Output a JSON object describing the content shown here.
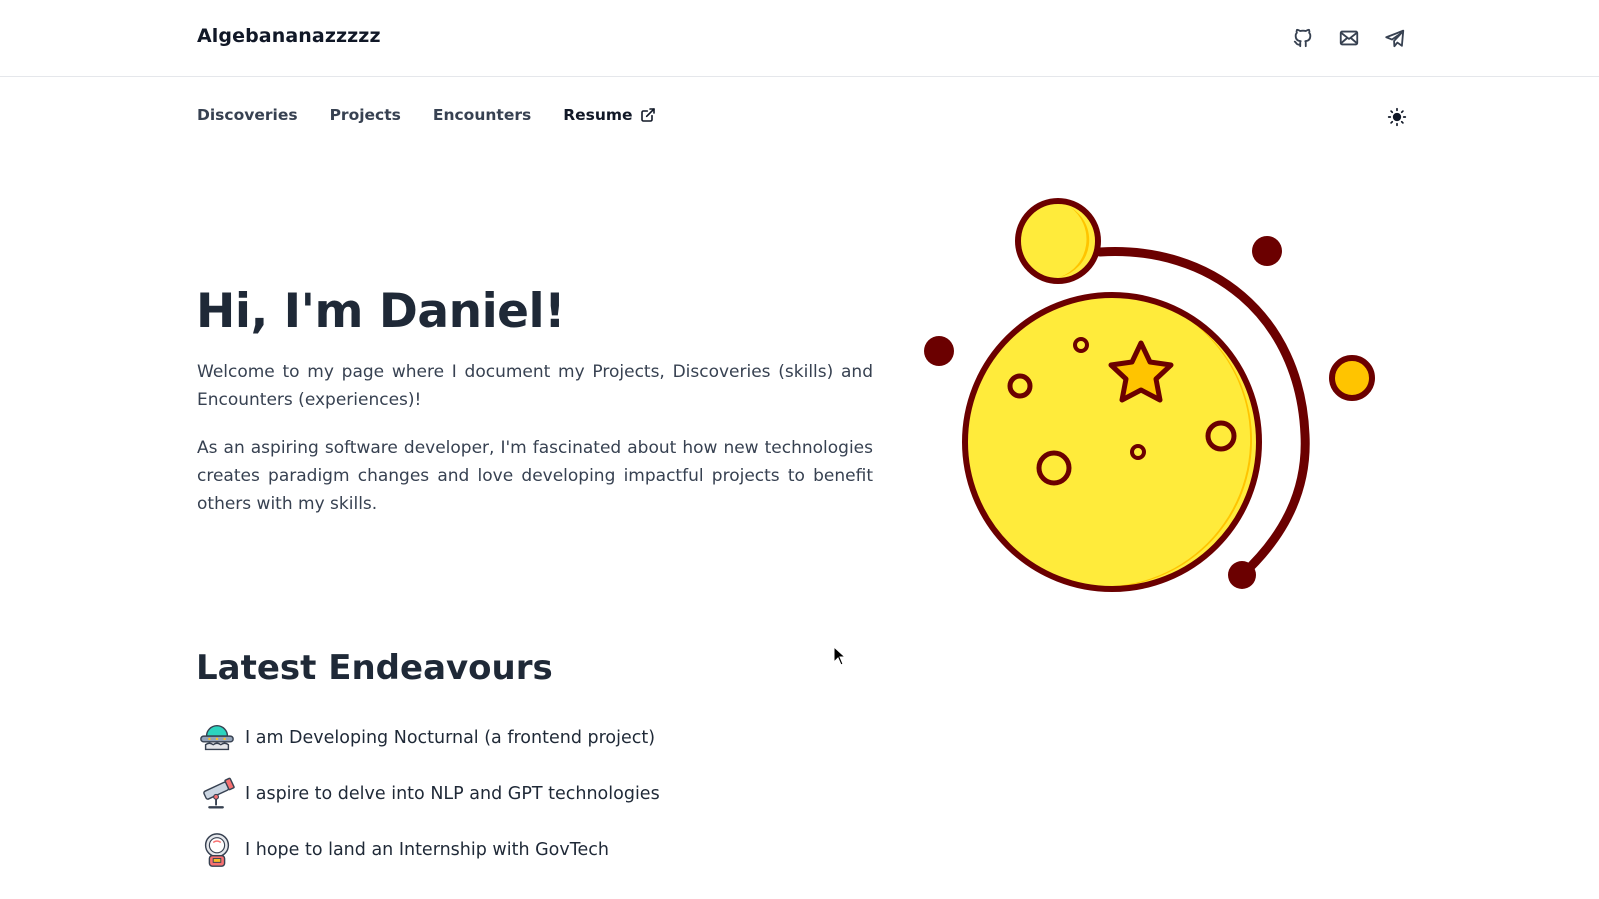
{
  "header": {
    "brand": "Algebananazzzzz",
    "icons": [
      "github-icon",
      "mail-icon",
      "telegram-icon"
    ]
  },
  "nav": {
    "items": [
      {
        "label": "Discoveries"
      },
      {
        "label": "Projects"
      },
      {
        "label": "Encounters"
      },
      {
        "label": "Resume"
      }
    ],
    "theme_toggle_icon": "sun-icon"
  },
  "hero": {
    "title": "Hi, I'm Daniel!",
    "paragraph1": "Welcome to my page where I document my Projects, Discoveries (skills) and Encounters (experiences)!",
    "paragraph2": "As an aspiring software developer, I'm fascinated about how new technologies creates paradigm changes and love developing impactful projects to benefit others with my skills."
  },
  "endeavours": {
    "title": "Latest Endeavours",
    "items": [
      {
        "icon": "ufo-icon",
        "text": "I am Developing Nocturnal (a frontend project)"
      },
      {
        "icon": "telescope-icon",
        "text": "I aspire to delve into NLP and GPT technologies"
      },
      {
        "icon": "astronaut-icon",
        "text": "I hope to land an Internship with GovTech"
      }
    ]
  },
  "colors": {
    "planet_fill": "#ffeb3b",
    "planet_shade": "#ffc400",
    "outline": "#6b0000",
    "text_primary": "#1f2937"
  }
}
